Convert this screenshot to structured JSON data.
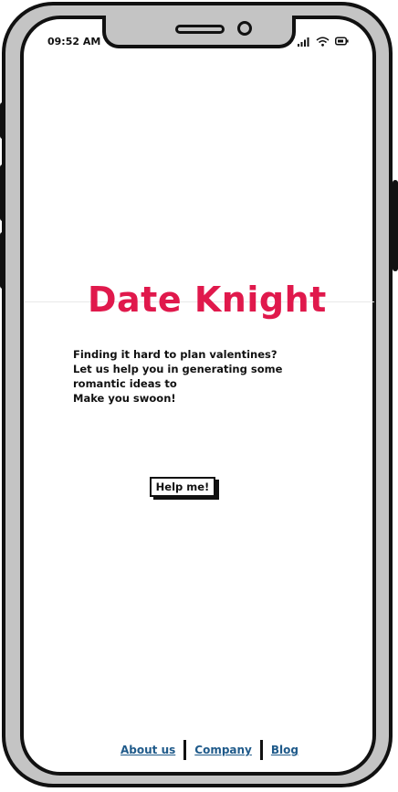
{
  "status_bar": {
    "time": "09:52 AM",
    "icons": [
      "signal-icon",
      "wifi-icon",
      "battery-icon"
    ]
  },
  "app": {
    "title": "Date Knight",
    "title_color": "#e0194c",
    "tagline_lines": [
      "Finding it hard to plan valentines?",
      "Let us help you in generating some romantic ideas to",
      "Make you swoon!"
    ],
    "cta_label": "Help me!"
  },
  "footer": {
    "links": [
      "About us",
      "Company",
      "Blog"
    ],
    "link_color": "#1f5a8a"
  }
}
